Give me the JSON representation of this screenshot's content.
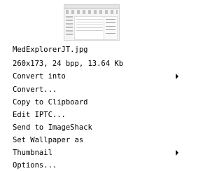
{
  "thumbnail": {
    "alt": "MedExplorerJT.jpg thumbnail"
  },
  "info": {
    "filename": "MedExplorerJT.jpg",
    "details": "260x173, 24 bpp, 13.64 Kb"
  },
  "menu": {
    "items": [
      {
        "label": "Convert into",
        "submenu": true,
        "submenu_icon": "chevron-right-icon"
      },
      {
        "label": "Convert...",
        "submenu": false
      },
      {
        "label": "Copy to Clipboard",
        "submenu": false
      },
      {
        "label": "Edit IPTC...",
        "submenu": false
      },
      {
        "label": "Send to ImageShack",
        "submenu": false
      },
      {
        "label": "Set Wallpaper as",
        "submenu": false
      },
      {
        "label": "Thumbnail",
        "submenu": true,
        "submenu_icon": "chevron-right-icon"
      },
      {
        "label": "Options...",
        "submenu": false
      }
    ]
  }
}
